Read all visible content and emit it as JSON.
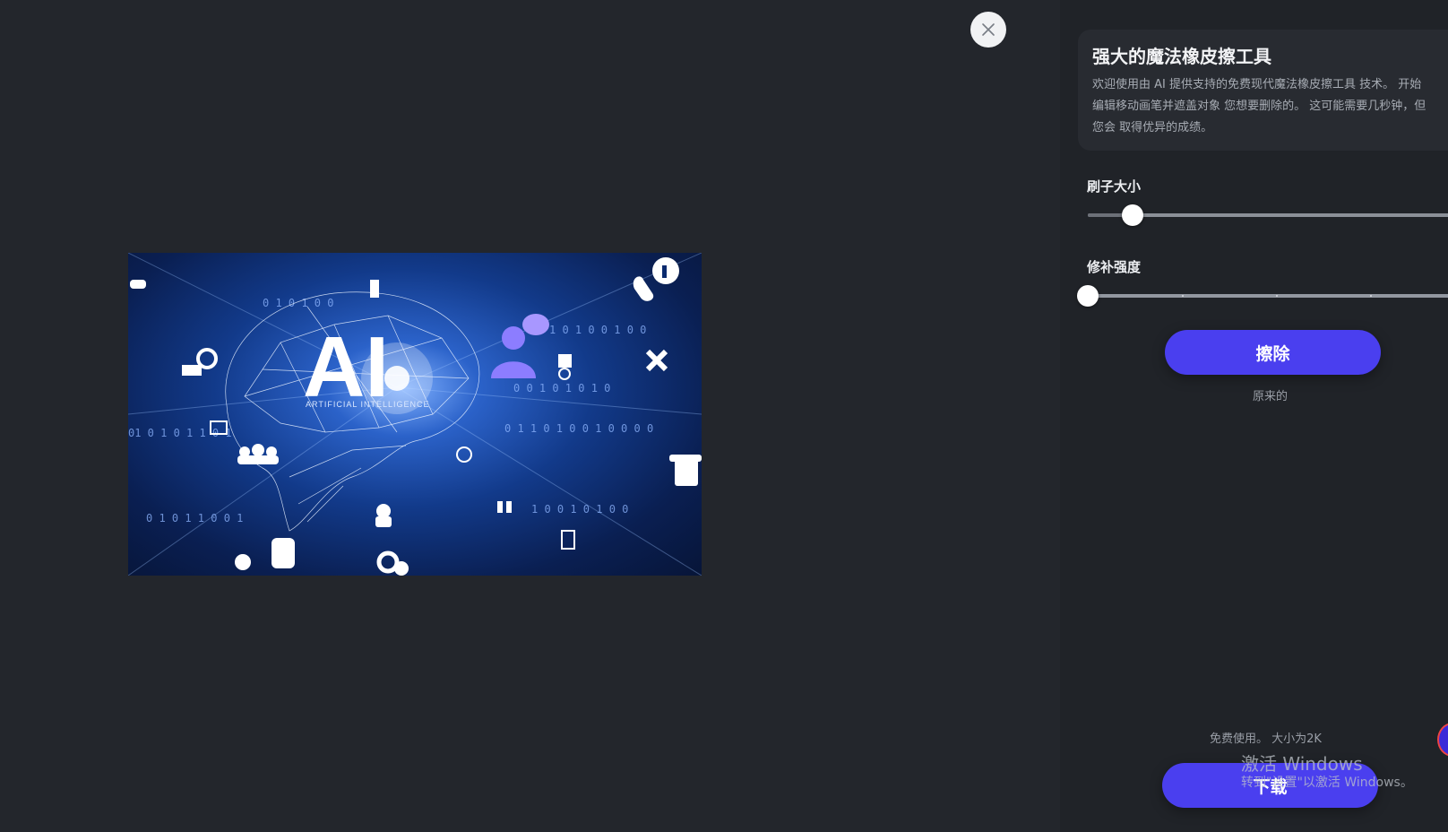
{
  "colors": {
    "accent": "#4a3fef",
    "background": "#23262c",
    "sidebar": "#202328",
    "card": "#282b31"
  },
  "editor": {
    "close_icon": "close-icon",
    "preview": {
      "headline": "AI",
      "tagline": "ARTIFICIAL INTELLIGENCE"
    }
  },
  "sidebar": {
    "info": {
      "title": "强大的魔法橡皮擦工具",
      "lines": [
        "欢迎使用由 AI 提供支持的免费现代魔法橡皮擦工具 技术。 开始",
        "编辑移动画笔并遮盖对象 您想要删除的。 这可能需要几秒钟，但",
        "您会 取得优异的成绩。"
      ]
    },
    "brush_size": {
      "label": "刷子大小",
      "value": 0.12
    },
    "repair_strength": {
      "label": "修补强度",
      "value": 0
    },
    "erase_button": "擦除",
    "original_link": "原来的",
    "usage_note": "免费使用。 大小为2K",
    "download_button": "下载"
  },
  "os_watermark": {
    "title": "激活 Windows",
    "subtitle": "转到\"设置\"以激活 Windows。"
  }
}
